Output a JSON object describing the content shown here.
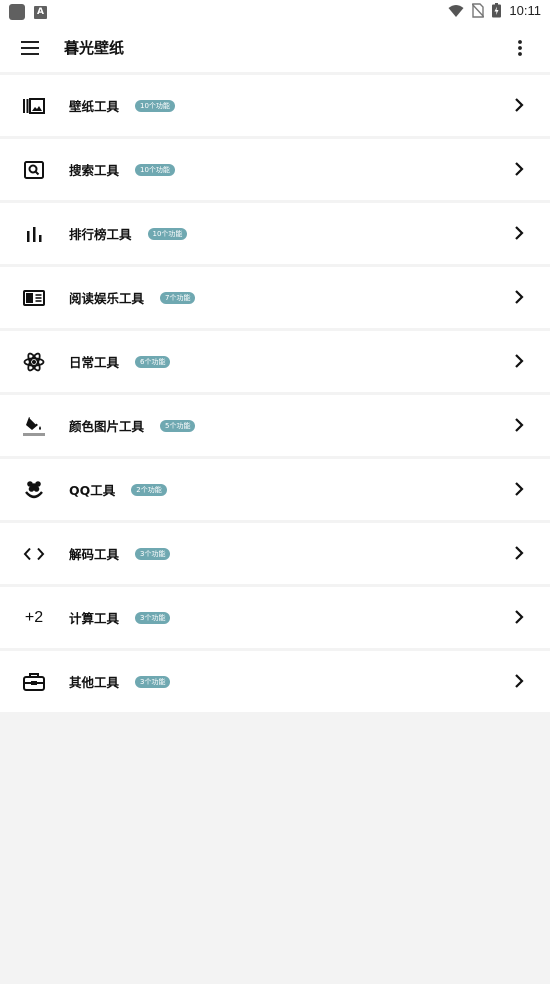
{
  "status_bar": {
    "time": "10:11"
  },
  "app_bar": {
    "title": "暮光壁纸"
  },
  "categories": [
    {
      "icon": "wallpaper-gallery-icon",
      "label": "壁纸工具",
      "badge": "10个功能"
    },
    {
      "icon": "image-search-icon",
      "label": "搜索工具",
      "badge": "10个功能"
    },
    {
      "icon": "bar-chart-icon",
      "label": "排行榜工具",
      "badge": "10个功能"
    },
    {
      "icon": "book-reader-icon",
      "label": "阅读娱乐工具",
      "badge": "7个功能"
    },
    {
      "icon": "atom-icon",
      "label": "日常工具",
      "badge": "6个功能"
    },
    {
      "icon": "paint-bucket-icon",
      "label": "颜色图片工具",
      "badge": "5个功能"
    },
    {
      "icon": "flower-icon",
      "label": "QQ工具",
      "badge": "2个功能"
    },
    {
      "icon": "code-icon",
      "label": "解码工具",
      "badge": "3个功能"
    },
    {
      "icon": "plus-two-icon",
      "icon_text": "+2",
      "label": "计算工具",
      "badge": "3个功能"
    },
    {
      "icon": "toolbox-icon",
      "label": "其他工具",
      "badge": "3个功能"
    }
  ]
}
